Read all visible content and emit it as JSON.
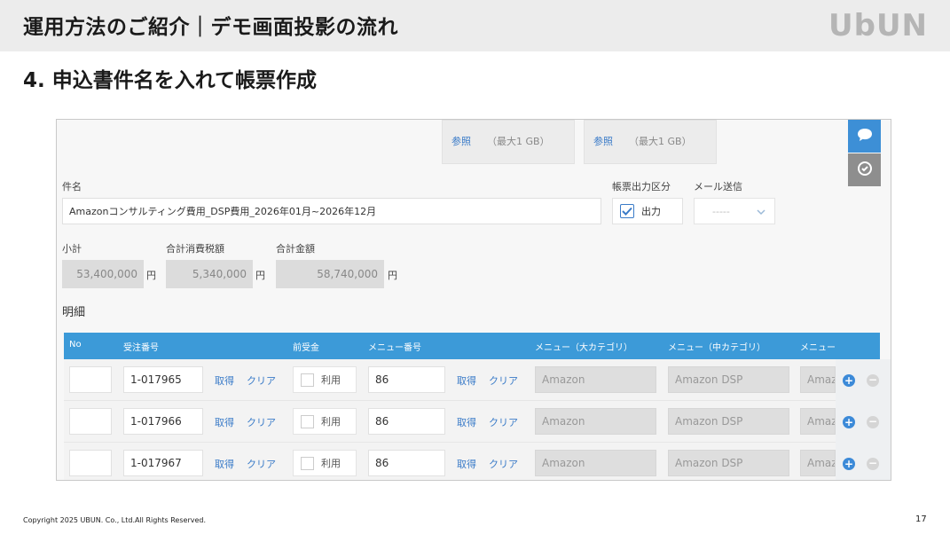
{
  "slide": {
    "title": "運用方法のご紹介｜デモ画面投影の流れ",
    "logo": "UbUN",
    "step": "4.  申込書件名を入れて帳票作成",
    "copyright": "Copyright 2025 UBUN. Co., Ltd.All Rights Reserved.",
    "page_number": "17"
  },
  "form": {
    "attachments": [
      {
        "link": "参照",
        "note": "（最大1 GB）"
      },
      {
        "link": "参照",
        "note": "（最大1 GB）"
      }
    ],
    "subject_label": "件名",
    "subject_value": "Amazonコンサルティング費用_DSP費用_2026年01月~2026年12月",
    "output_type_label": "帳票出力区分",
    "output_checkbox_label": "出力",
    "mail_label": "メール送信",
    "mail_select_value": "-----",
    "subtotal_label": "小計",
    "subtotal_value": "53,400,000",
    "tax_label": "合計消費税額",
    "tax_value": "5,340,000",
    "total_label": "合計金額",
    "total_value": "58,740,000",
    "yen": "円",
    "details_label": "明細"
  },
  "table": {
    "headers": {
      "no": "No",
      "order_no": "受注番号",
      "prepaid": "前受金",
      "menu_no": "メニュー番号",
      "menu_large": "メニュー（大カテゴリ）",
      "menu_mid": "メニュー（中カテゴリ）",
      "menu_more": "メニュー"
    },
    "get_label": "取得",
    "clear_label": "クリア",
    "use_label": "利用",
    "rows": [
      {
        "order_no": "1-017965",
        "menu_no": "86",
        "menu_large": "Amazon",
        "menu_mid": "Amazon DSP",
        "menu_more": "Amazon"
      },
      {
        "order_no": "1-017966",
        "menu_no": "86",
        "menu_large": "Amazon",
        "menu_mid": "Amazon DSP",
        "menu_more": "Amazon"
      },
      {
        "order_no": "1-017967",
        "menu_no": "86",
        "menu_large": "Amazon",
        "menu_mid": "Amazon DSP",
        "menu_more": "Amazon"
      }
    ]
  },
  "icons": {
    "chat": "chat-bubble-icon",
    "history": "clock-check-icon",
    "add": "plus-circle-icon",
    "remove": "minus-circle-icon",
    "check": "check-icon",
    "dropdown": "chevron-down-icon"
  },
  "colors": {
    "accent": "#3c9ad8",
    "side_button": "#3d8fd6",
    "side_button_gray": "#8e8e8e"
  }
}
